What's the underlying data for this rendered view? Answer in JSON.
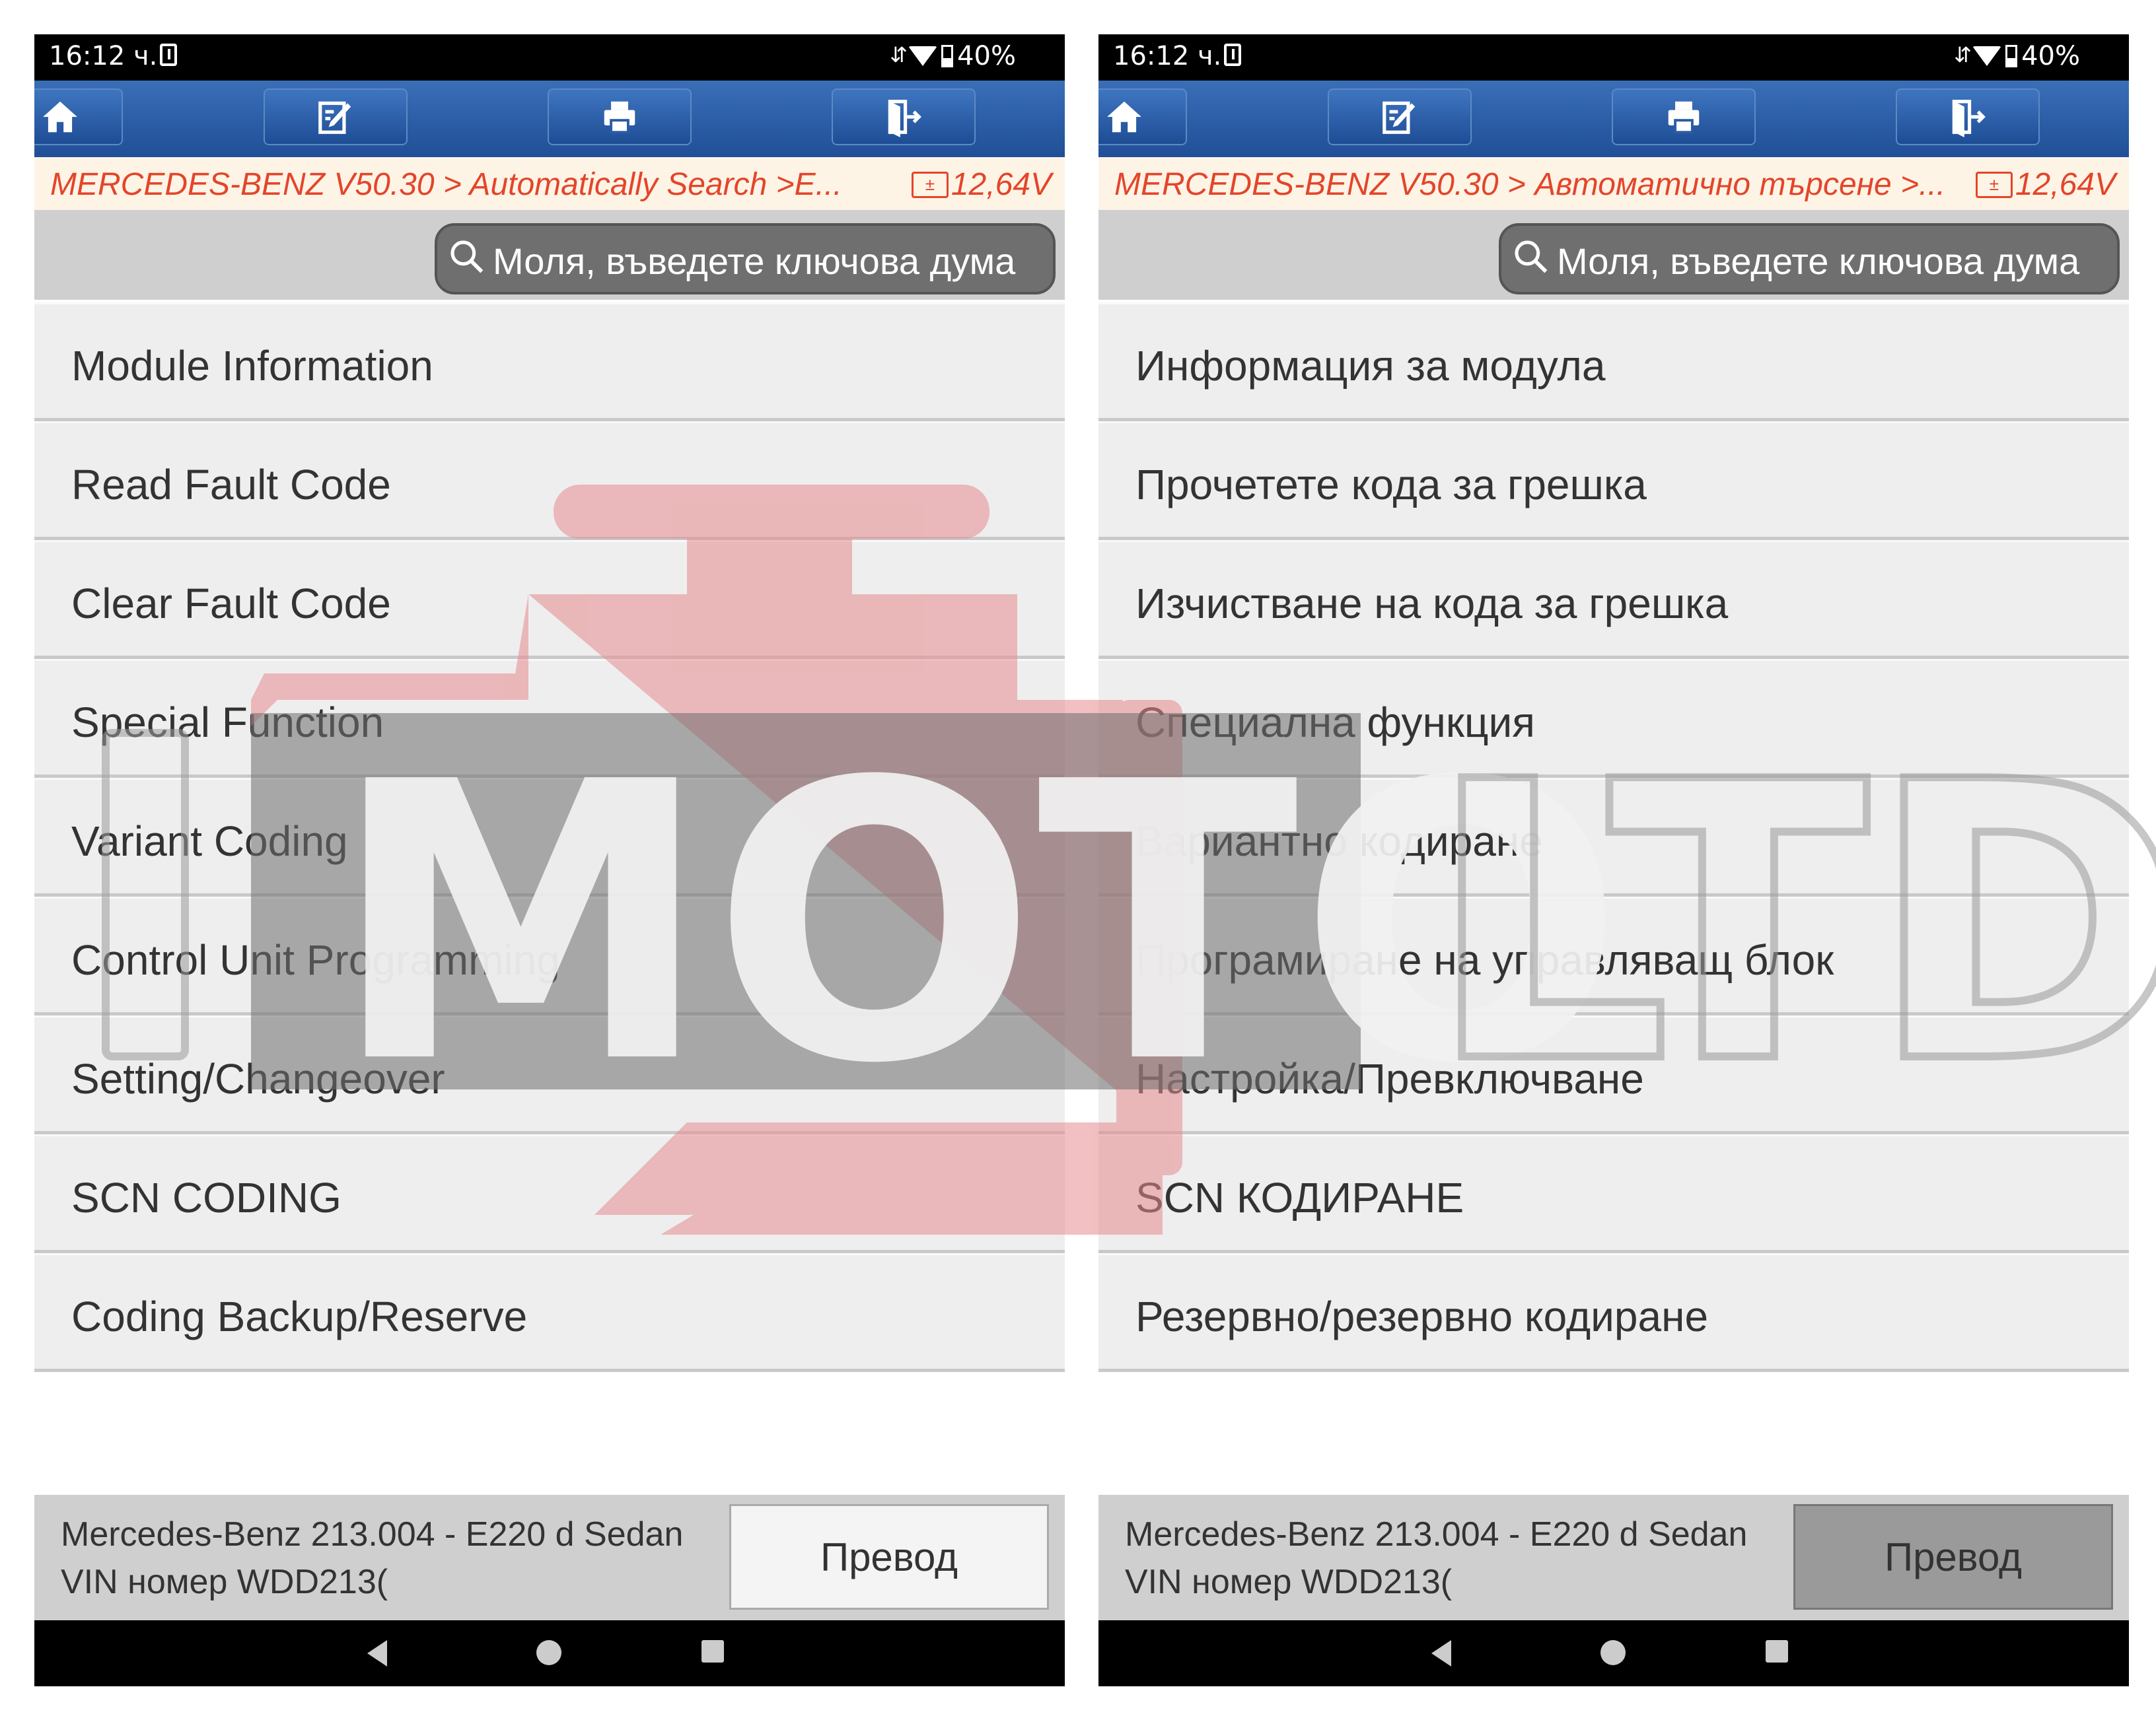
{
  "panels": [
    {
      "status": {
        "time": "16:12 ч.",
        "battery": "40%"
      },
      "breadcrumb": "MERCEDES-BENZ V50.30 > Automatically Search >E...",
      "voltage": "12,64V",
      "search": {
        "placeholder": "Моля, въведете ключова дума"
      },
      "menu": [
        "Module Information",
        "Read Fault Code",
        "Clear Fault Code",
        "Special Function",
        "Variant Coding",
        "Control Unit Programming",
        "Setting/Changeover",
        "SCN CODING",
        "Coding Backup/Reserve"
      ],
      "footer": {
        "vehicle_line1": "Mercedes-Benz 213.004 - E220 d Sedan",
        "vehicle_line2": "VIN номер WDD213(",
        "translate_label": "Превод"
      }
    },
    {
      "status": {
        "time": "16:12 ч.",
        "battery": "40%"
      },
      "breadcrumb": "MERCEDES-BENZ V50.30 > Автоматично търсене >...",
      "voltage": "12,64V",
      "search": {
        "placeholder": "Моля, въведете ключова дума"
      },
      "menu": [
        "Информация за модула",
        "Прочетете кода за грешка",
        "Изчистване на кода за грешка",
        "Специална функция",
        "Вариантно кодиране",
        "Програмиране на управляващ блок",
        "Настройка/Превключване",
        "SCN КОДИРАНЕ",
        "Резервно/резервно кодиране"
      ],
      "footer": {
        "vehicle_line1": "Mercedes-Benz 213.004 - E220 d Sedan",
        "vehicle_line2": "VIN номер WDD213(",
        "translate_label": "Превод"
      }
    }
  ],
  "watermark": {
    "text_main": "MOTO",
    "text_suffix": "LTD",
    "color_accent": "#e88b8f"
  },
  "icons": [
    "home-icon",
    "edit-icon",
    "print-icon",
    "exit-icon",
    "search-icon",
    "battery-icon"
  ]
}
